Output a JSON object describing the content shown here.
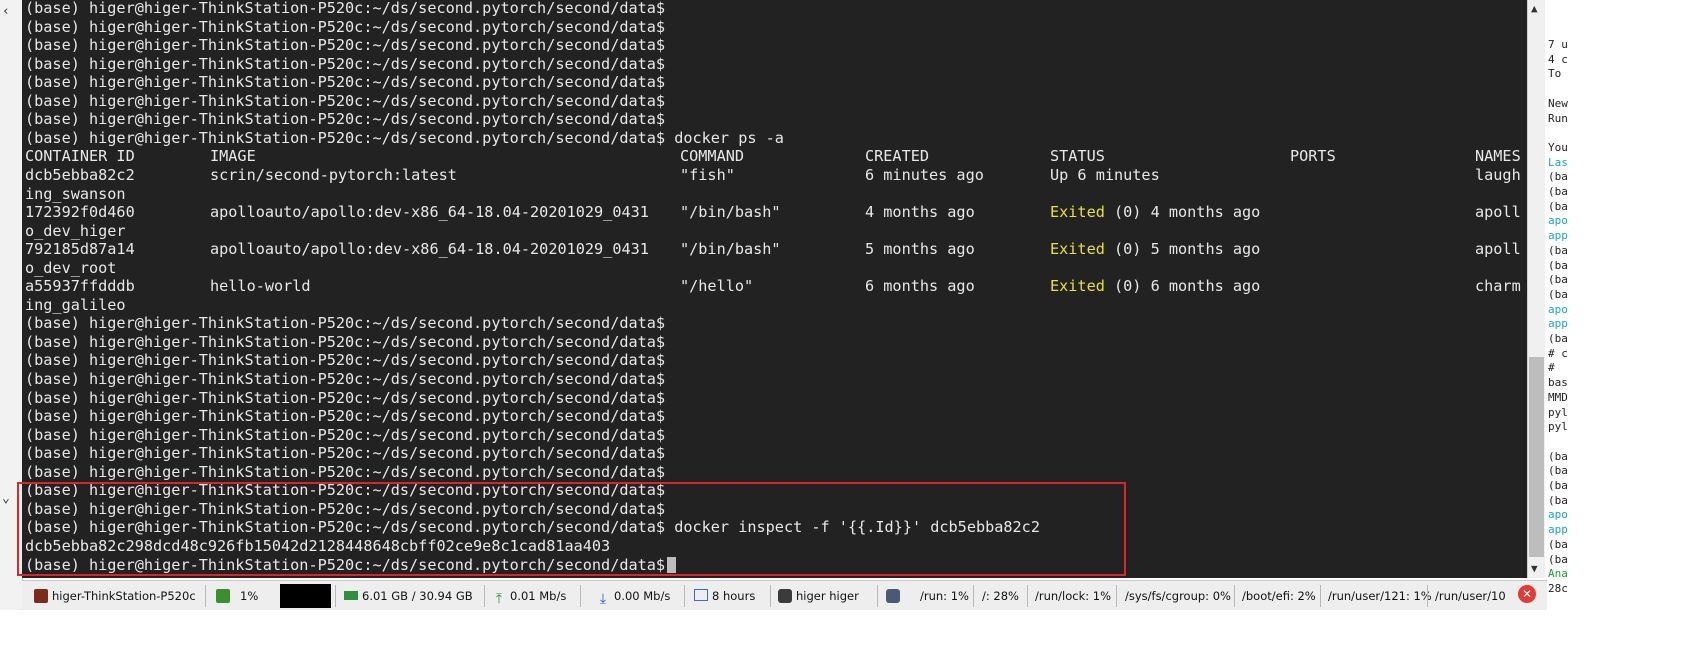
{
  "terminal": {
    "prompt": "(base) higer@higer-ThinkStation-P520c:~/ds/second.pytorch/second/data$",
    "cmd_ps": "docker ps -a",
    "cmd_inspect": "docker inspect -f '{{.Id}}' dcb5ebba82c2",
    "inspect_output": "dcb5ebba82c298dcd48c926fb15042d2128448648cbff02ce9e8c1cad81aa403",
    "headers": [
      "CONTAINER ID",
      "IMAGE",
      "COMMAND",
      "CREATED",
      "STATUS",
      "PORTS",
      "NAMES"
    ],
    "rows": [
      {
        "id": "dcb5ebba82c2",
        "image": "scrin/second-pytorch:latest",
        "command": "\"fish\"",
        "created": "6 minutes ago",
        "status_word": "",
        "status_rest": "Up 6 minutes",
        "name_part1": "laugh",
        "name_part2": "ing_swanson"
      },
      {
        "id": "172392f0d460",
        "image": "apolloauto/apollo:dev-x86_64-18.04-20201029_0431",
        "command": "\"/bin/bash\"",
        "created": "4 months ago",
        "status_word": "Exited",
        "status_rest": " (0) 4 months ago",
        "name_part1": "apoll",
        "name_part2": "o_dev_higer"
      },
      {
        "id": "792185d87a14",
        "image": "apolloauto/apollo:dev-x86_64-18.04-20201029_0431",
        "command": "\"/bin/bash\"",
        "created": "5 months ago",
        "status_word": "Exited",
        "status_rest": " (0) 5 months ago",
        "name_part1": "apoll",
        "name_part2": "o_dev_root"
      },
      {
        "id": "a55937ffdddb",
        "image": "hello-world",
        "command": "\"/hello\"",
        "created": "6 months ago",
        "status_word": "Exited",
        "status_rest": " (0) 6 months ago",
        "name_part1": "charm",
        "name_part2": "ing_galileo"
      }
    ]
  },
  "right_panel": {
    "lines": [
      {
        "text": "7 u",
        "style": "plain"
      },
      {
        "text": "4 c",
        "style": "plain"
      },
      {
        "text": "To",
        "style": "plain"
      },
      {
        "text": "",
        "style": "plain"
      },
      {
        "text": "New",
        "style": "plain"
      },
      {
        "text": "Run",
        "style": "plain"
      },
      {
        "text": "",
        "style": "plain"
      },
      {
        "text": "You",
        "style": "plain"
      },
      {
        "text": "Las",
        "style": "cyan"
      },
      {
        "text": "(ba",
        "style": "plain"
      },
      {
        "text": "(ba",
        "style": "plain"
      },
      {
        "text": "(ba",
        "style": "plain"
      },
      {
        "text": "apo",
        "style": "cyan"
      },
      {
        "text": "app",
        "style": "cyan"
      },
      {
        "text": "(ba",
        "style": "plain"
      },
      {
        "text": "(ba",
        "style": "plain"
      },
      {
        "text": "(ba",
        "style": "plain"
      },
      {
        "text": "(ba",
        "style": "plain"
      },
      {
        "text": "apo",
        "style": "cyan"
      },
      {
        "text": "app",
        "style": "cyan"
      },
      {
        "text": "(ba",
        "style": "plain"
      },
      {
        "text": "# c",
        "style": "plain"
      },
      {
        "text": "#",
        "style": "plain"
      },
      {
        "text": "bas",
        "style": "plain"
      },
      {
        "text": "MMD",
        "style": "plain"
      },
      {
        "text": "pyl",
        "style": "plain"
      },
      {
        "text": "pyl",
        "style": "plain"
      },
      {
        "text": "",
        "style": "plain"
      },
      {
        "text": "(ba",
        "style": "plain"
      },
      {
        "text": "(ba",
        "style": "plain"
      },
      {
        "text": "(ba",
        "style": "plain"
      },
      {
        "text": "(ba",
        "style": "plain"
      },
      {
        "text": "apo",
        "style": "cyan"
      },
      {
        "text": "app",
        "style": "cyan"
      },
      {
        "text": "(ba",
        "style": "plain"
      },
      {
        "text": "(ba",
        "style": "plain"
      },
      {
        "text": "Ana",
        "style": "green"
      },
      {
        "text": "28c",
        "style": "plain"
      }
    ]
  },
  "statusbar": {
    "host": "higer-ThinkStation-P520c",
    "cpu": "1%",
    "memory": "6.01 GB / 30.94 GB",
    "upload": "0.01 Mb/s",
    "download": "0.00 Mb/s",
    "uptime": "8 hours",
    "user": "higer  higer",
    "disks": [
      "/run: 1%",
      "/: 28%",
      "/run/lock: 1%",
      "/sys/fs/cgroup: 0%",
      "/boot/efi: 2%",
      "/run/user/121: 1%",
      "/run/user/10"
    ]
  },
  "colors": {
    "terminal_bg": "#222222",
    "terminal_fg": "#e8e8e8",
    "exited": "#e8e03c",
    "highlight": "#d9262b"
  }
}
